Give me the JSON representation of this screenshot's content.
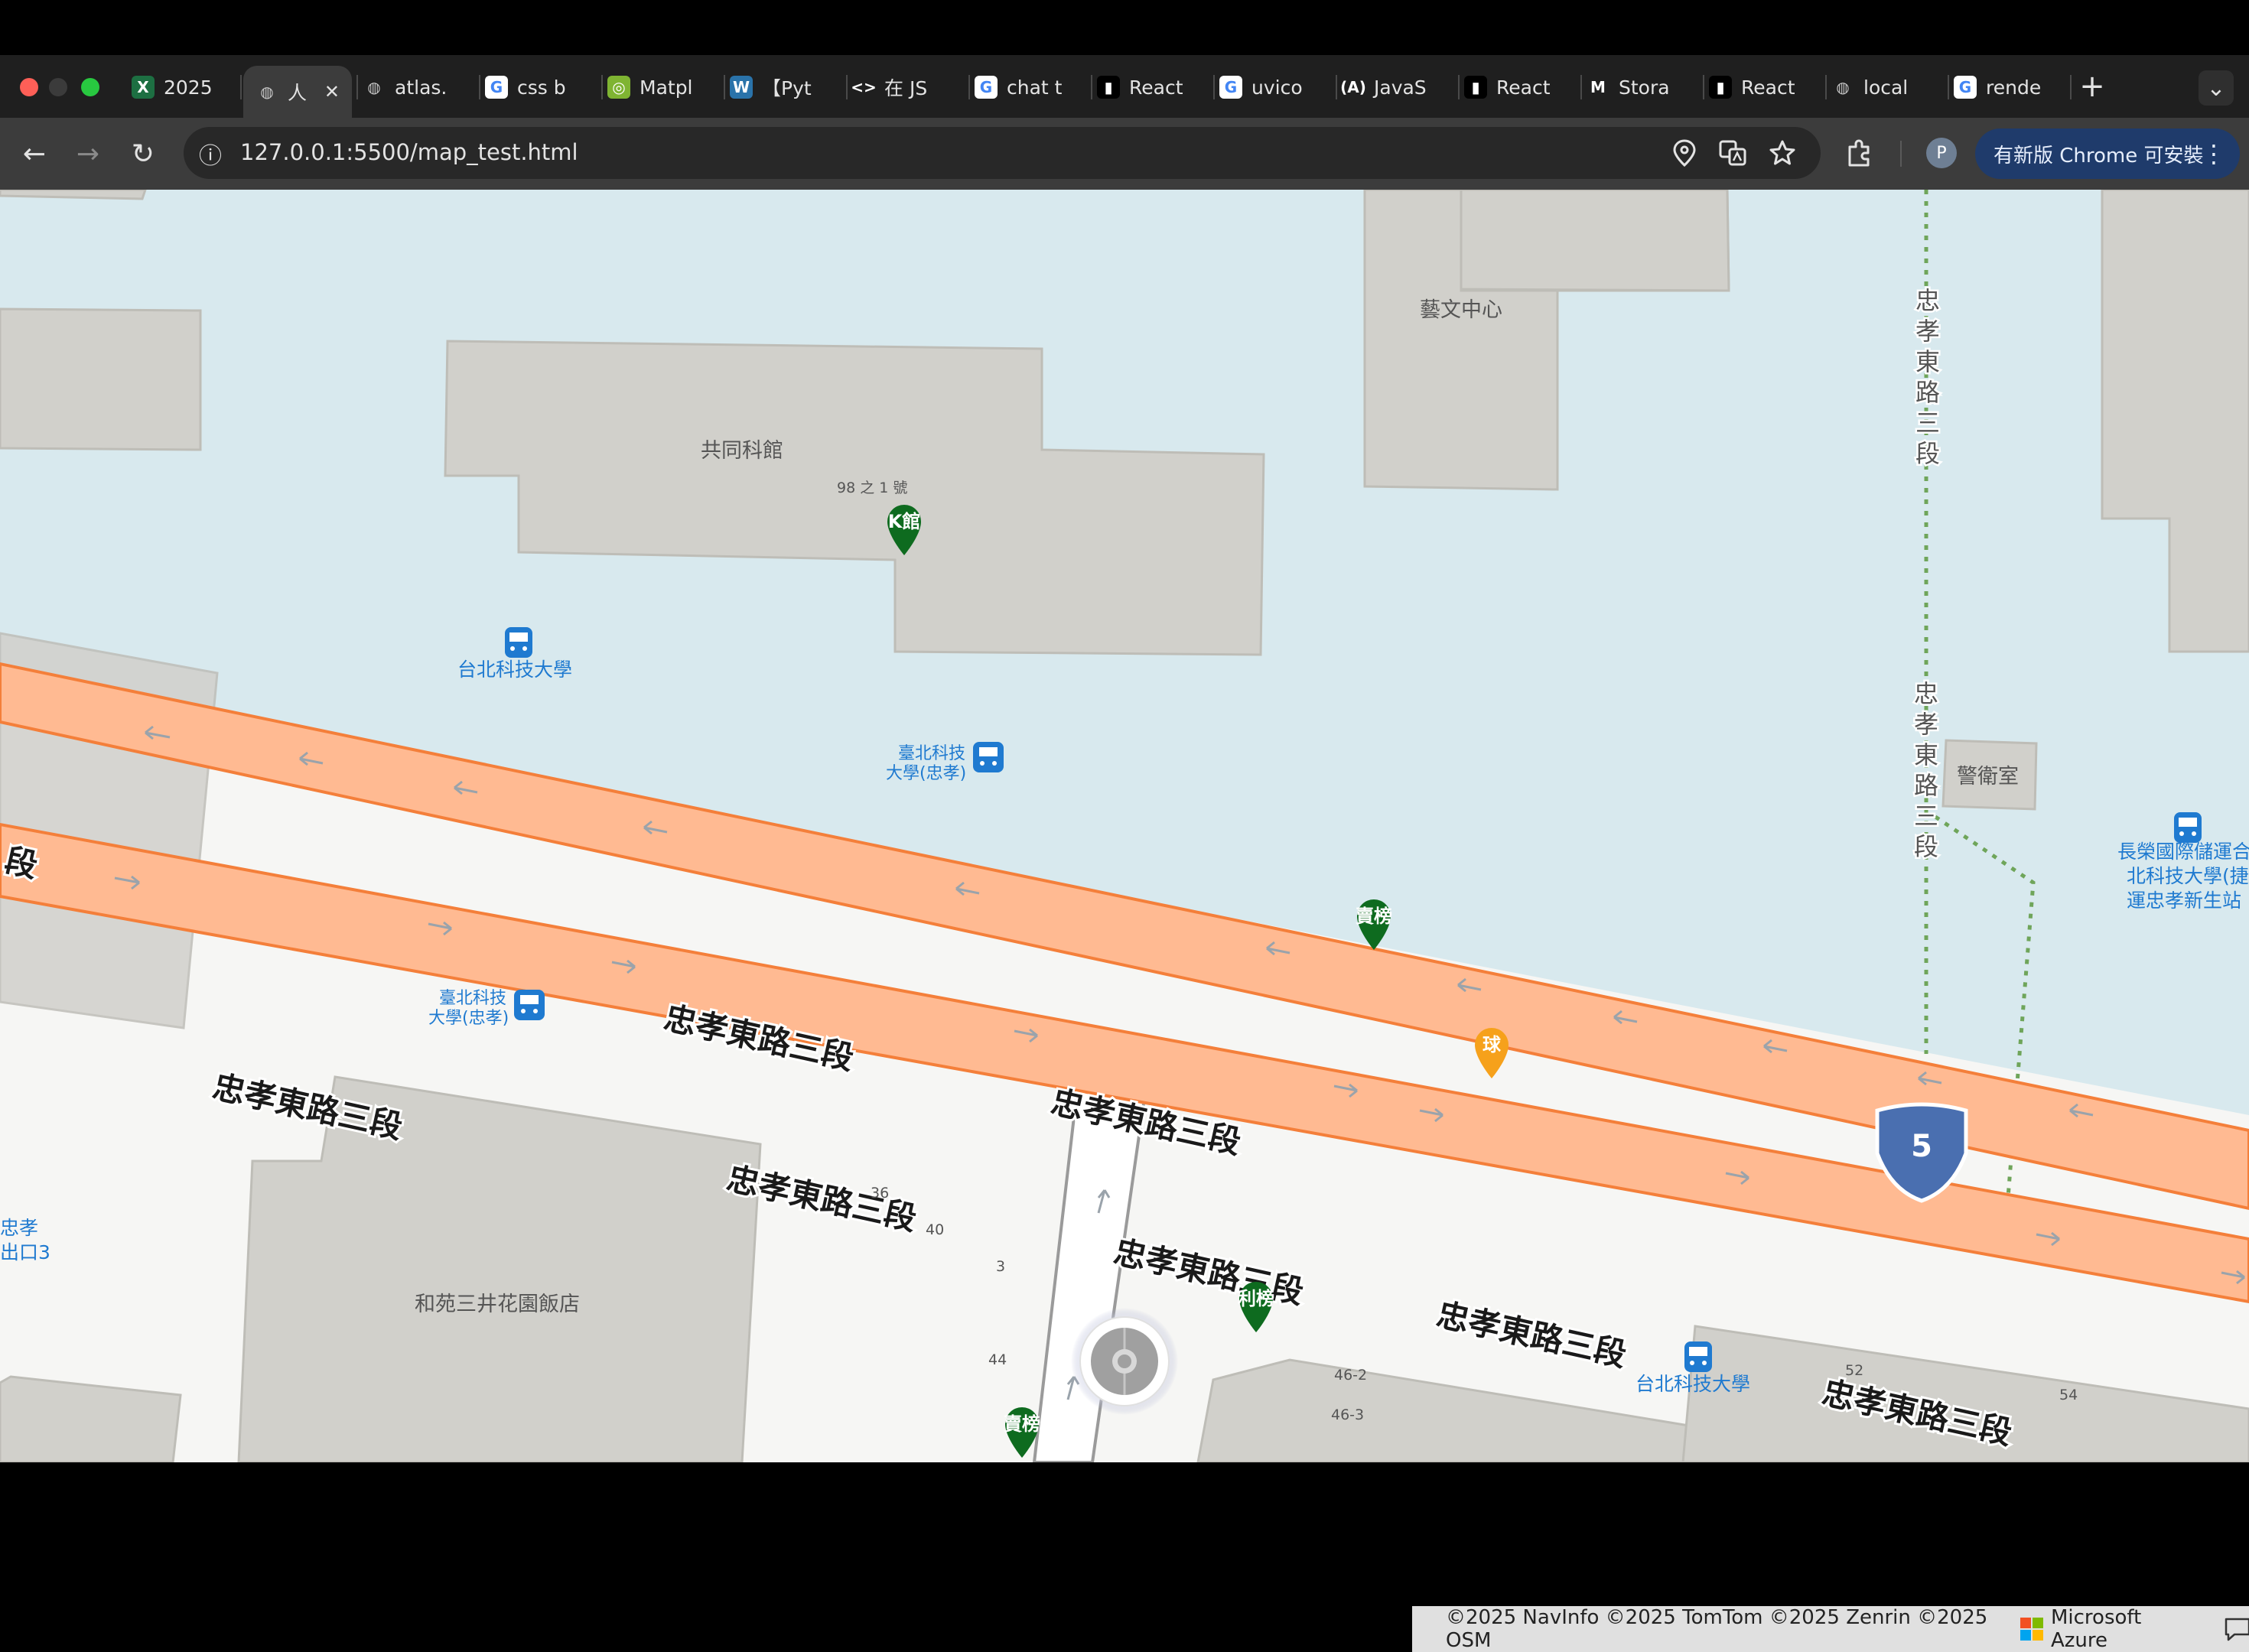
{
  "browser": {
    "tabs": [
      {
        "label": "2025",
        "icon": "excel-icon"
      },
      {
        "label": "人",
        "icon": "globe-icon",
        "active": true
      },
      {
        "label": "atlas.",
        "icon": "globe-icon"
      },
      {
        "label": "css b",
        "icon": "google-icon"
      },
      {
        "label": "Matpl",
        "icon": "matplotlib-icon"
      },
      {
        "label": "【Pyt",
        "icon": "wordpress-icon"
      },
      {
        "label": "在 JS",
        "icon": "code-icon"
      },
      {
        "label": "chat t",
        "icon": "google-icon"
      },
      {
        "label": "React",
        "icon": "medium-icon"
      },
      {
        "label": "uvico",
        "icon": "google-icon"
      },
      {
        "label": "JavaS",
        "icon": "a-icon"
      },
      {
        "label": "React",
        "icon": "medium-icon"
      },
      {
        "label": "Stora",
        "icon": "m-icon"
      },
      {
        "label": "React",
        "icon": "medium-icon"
      },
      {
        "label": "local",
        "icon": "globe-icon"
      },
      {
        "label": "rende",
        "icon": "google-icon"
      }
    ],
    "tab_glyphs": {
      "new_tab": "+",
      "close": "✕",
      "tab_search": "⌄",
      "code": "<>",
      "a": "(A)",
      "m": "M",
      "medium": "▮"
    },
    "url": "127.0.0.1:5500/map_test.html",
    "update_button": "有新版 Chrome 可安裝",
    "update_menu_glyph": "⋮",
    "profile_initial": "P",
    "nav_glyphs": {
      "back": "←",
      "forward": "→",
      "reload": "↻",
      "site_info": "ⓘ"
    }
  },
  "map": {
    "colors": {
      "water": "#d8e9ee",
      "land": "#f6f6f4",
      "building": "#d1d0cb",
      "building_stroke": "#bebdb7",
      "road_fill": "#ffba92",
      "road_edge": "#f47f3a",
      "transit_blue": "#1f7ad0",
      "poi_green": "#0e6b1f",
      "poi_orange": "#f6a11b",
      "shield": "#4a6fb0",
      "footpath": "#6fa55a"
    },
    "labels": {
      "common_building": "共同科館",
      "arts_center": "藝文中心",
      "address_98_1": "98 之 1 號",
      "guard_room": "警衛室",
      "hotel": "和苑三井花園飯店",
      "road_vertical": "忠孝東路三段",
      "road_main": "忠孝東路三段",
      "road_main_short": "段",
      "bus_stop_1": "台北科技大學",
      "bus_stop_2_line1": "臺北科技",
      "bus_stop_2_line2": "大學(忠孝)",
      "bus_stop_3_line1": "臺北科技",
      "bus_stop_3_line2": "大學(忠孝)",
      "bus_stop_4": "台北科技大學",
      "bus_stop_5_line1": "長榮國際儲運合",
      "bus_stop_5_line2": "北科技大學(捷",
      "bus_stop_5_line3": "運忠孝新生站",
      "exit_line1": "忠孝",
      "exit_line2": "出口3",
      "poi_1": "K館",
      "poi_2": "賣榜",
      "poi_3": "球",
      "poi_4": "利榜",
      "poi_5": "賣榜",
      "shield_number": "5"
    },
    "address_numbers": [
      "36",
      "40",
      "3",
      "44",
      "46-2",
      "46-3",
      "52",
      "54"
    ],
    "attribution": "©2025 NavInfo ©2025 TomTom ©2025 Zenrin ©2025 OSM",
    "azure_label": "Microsoft Azure"
  }
}
